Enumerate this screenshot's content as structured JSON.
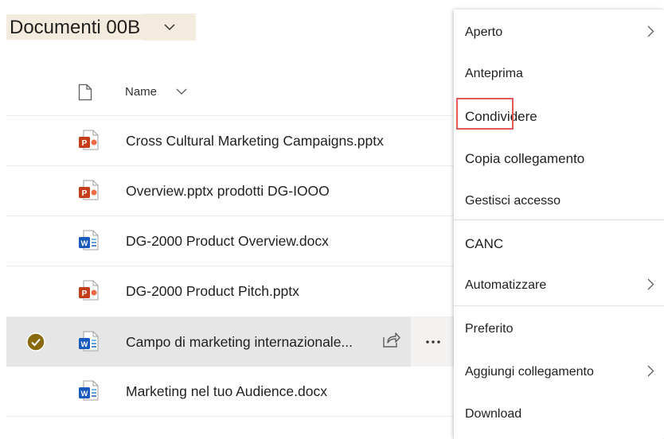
{
  "library": {
    "title": "Documenti 00B"
  },
  "columns": {
    "name": "Name"
  },
  "files": [
    {
      "name": "Cross Cultural Marketing Campaigns.pptx",
      "type": "pptx"
    },
    {
      "name": "Overview.pptx prodotti DG-IOOO",
      "type": "pptx"
    },
    {
      "name": "DG-2000 Product Overview.docx",
      "type": "docx"
    },
    {
      "name": "DG-2000 Product Pitch.pptx",
      "type": "pptx"
    },
    {
      "name": "Campo di marketing internazionale...",
      "type": "docx",
      "selected": true
    },
    {
      "name": "Marketing nel tuo Audience.docx",
      "type": "docx"
    }
  ],
  "menu": {
    "items": [
      {
        "label": "Aperto",
        "submenu": true
      },
      {
        "label": "Anteprima"
      },
      {
        "label": "Condividere",
        "highlighted": true
      },
      {
        "label": "Copia collegamento"
      },
      {
        "label": "Gestisci accesso"
      },
      {
        "label": "CANC"
      },
      {
        "label": "Automatizzare",
        "submenu": true
      },
      {
        "label": "Preferito"
      },
      {
        "label": "Aggiungi collegamento",
        "submenu": true
      },
      {
        "label": "Download"
      }
    ]
  },
  "colors": {
    "title_bg": "#f3ebde",
    "selected_row": "#e6e6e6",
    "check_fill": "#8a6a10",
    "pptx": "#c43e1c",
    "docx": "#185abd",
    "highlight_box": "#e05a5a"
  }
}
